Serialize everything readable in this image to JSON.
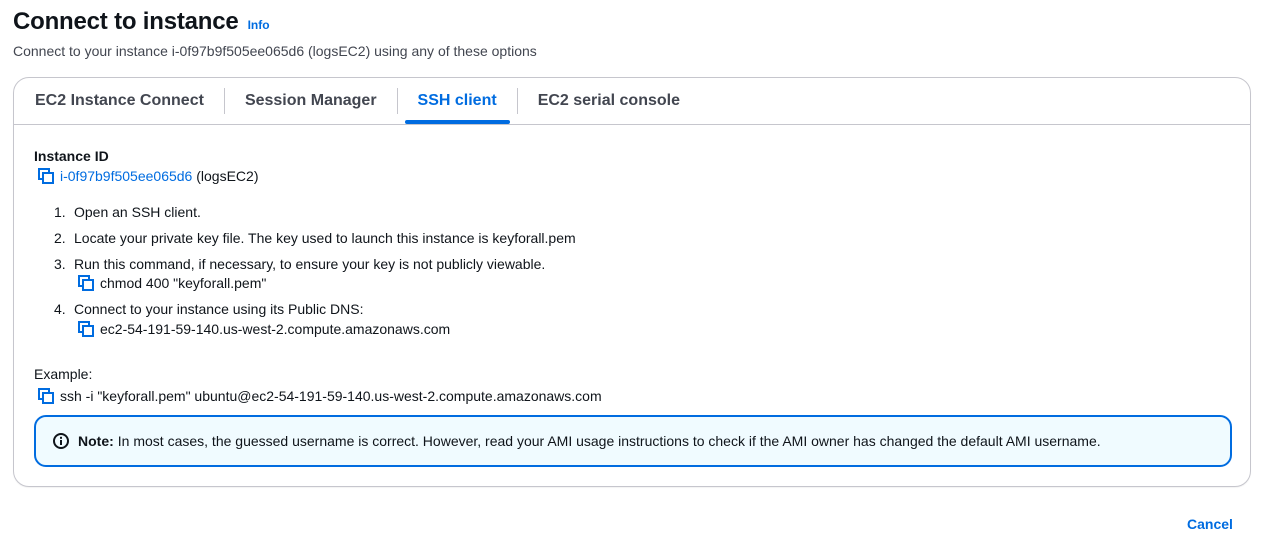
{
  "header": {
    "title": "Connect to instance",
    "info_link": "Info",
    "subtitle": "Connect to your instance i-0f97b9f505ee065d6 (logsEC2) using any of these options"
  },
  "tabs": [
    {
      "label": "EC2 Instance Connect",
      "active": false
    },
    {
      "label": "Session Manager",
      "active": false
    },
    {
      "label": "SSH client",
      "active": true
    },
    {
      "label": "EC2 serial console",
      "active": false
    }
  ],
  "ssh_client": {
    "instance_id_label": "Instance ID",
    "instance_id": "i-0f97b9f505ee065d6",
    "instance_name": "(logsEC2)",
    "steps": [
      {
        "number": "1.",
        "text": "Open an SSH client."
      },
      {
        "number": "2.",
        "text": "Locate your private key file. The key used to launch this instance is keyforall.pem"
      },
      {
        "number": "3.",
        "text": "Run this command, if necessary, to ensure your key is not publicly viewable.",
        "command": "chmod 400 \"keyforall.pem\""
      },
      {
        "number": "4.",
        "text": "Connect to your instance using its Public DNS:",
        "command": "ec2-54-191-59-140.us-west-2.compute.amazonaws.com"
      }
    ],
    "example_label": "Example:",
    "example_command": "ssh -i \"keyforall.pem\" ubuntu@ec2-54-191-59-140.us-west-2.compute.amazonaws.com",
    "note_label": "Note:",
    "note_text": "In most cases, the guessed username is correct. However, read your AMI usage instructions to check if the AMI owner has changed the default AMI username."
  },
  "footer": {
    "cancel_label": "Cancel"
  },
  "icons": {
    "copy": "copy-icon",
    "info": "info-circle-icon"
  },
  "colors": {
    "link": "#006ce0",
    "text": "#0f141a",
    "border": "#c6c6cd",
    "info_bg": "#f0fbff"
  }
}
